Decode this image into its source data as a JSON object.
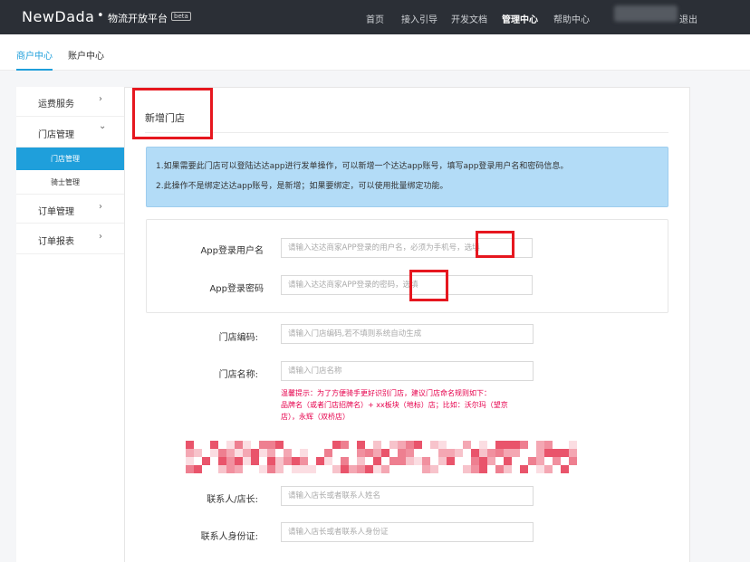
{
  "header": {
    "logo": "NewDada",
    "dot": "•",
    "platform": "物流开放平台",
    "badge": "beta",
    "nav": [
      {
        "label": "首页",
        "active": false
      },
      {
        "label": "接入引导",
        "active": false
      },
      {
        "label": "开发文档",
        "active": false
      },
      {
        "label": "管理中心",
        "active": true
      },
      {
        "label": "帮助中心",
        "active": false
      }
    ],
    "logout_fragment": "退出"
  },
  "subnav": {
    "items": [
      {
        "label": "商户中心",
        "active": true
      },
      {
        "label": "账户中心",
        "active": false
      }
    ]
  },
  "sidebar": {
    "items": [
      {
        "label": "运费服务",
        "arrow": "›"
      },
      {
        "label": "门店管理",
        "arrow": "⌄"
      },
      {
        "label": "订单管理",
        "arrow": "›"
      },
      {
        "label": "订单报表",
        "arrow": "›"
      }
    ],
    "subitems": [
      {
        "label": "门店管理",
        "active": true
      },
      {
        "label": "骑士管理",
        "active": false
      }
    ]
  },
  "content": {
    "title": "新增门店",
    "notice": [
      "1.如果需要此门店可以登陆达达app进行发单操作，可以新增一个达达app账号，填写app登录用户名和密码信息。",
      "2.此操作不是绑定达达app账号，是新增；如果要绑定，可以使用批量绑定功能。"
    ],
    "app_username": {
      "label": "App登录用户名",
      "placeholder": "请输入达达商家APP登录的用户名，必须为手机号，选填"
    },
    "app_password": {
      "label": "App登录密码",
      "placeholder": "请输入达达商家APP登录的密码，选填"
    },
    "shop_code": {
      "label": "门店编码:",
      "placeholder": "请输入门店编码,若不填则系统自动生成"
    },
    "shop_name": {
      "label": "门店名称:",
      "placeholder": "请输入门店名称"
    },
    "tip_lines": [
      "温馨提示：为了方便骑手更好识别门店，建议门店命名规则如下：",
      "品牌名（或者门店招牌名）+ xx板块（地标）店；比如：沃尔玛（望京",
      "店），永辉（双桥店）"
    ],
    "contact": {
      "label": "联系人/店长:",
      "placeholder": "请输入店长或者联系人姓名"
    },
    "contact_id": {
      "label": "联系人身份证:",
      "placeholder": "请输入店长或者联系人身份证"
    }
  },
  "colors": {
    "topbar": "#2b2f36",
    "accent": "#1f9fdb",
    "notice_bg": "#b3dcf7",
    "tip_text": "#e6004c",
    "annotation_red": "#e6171f"
  }
}
